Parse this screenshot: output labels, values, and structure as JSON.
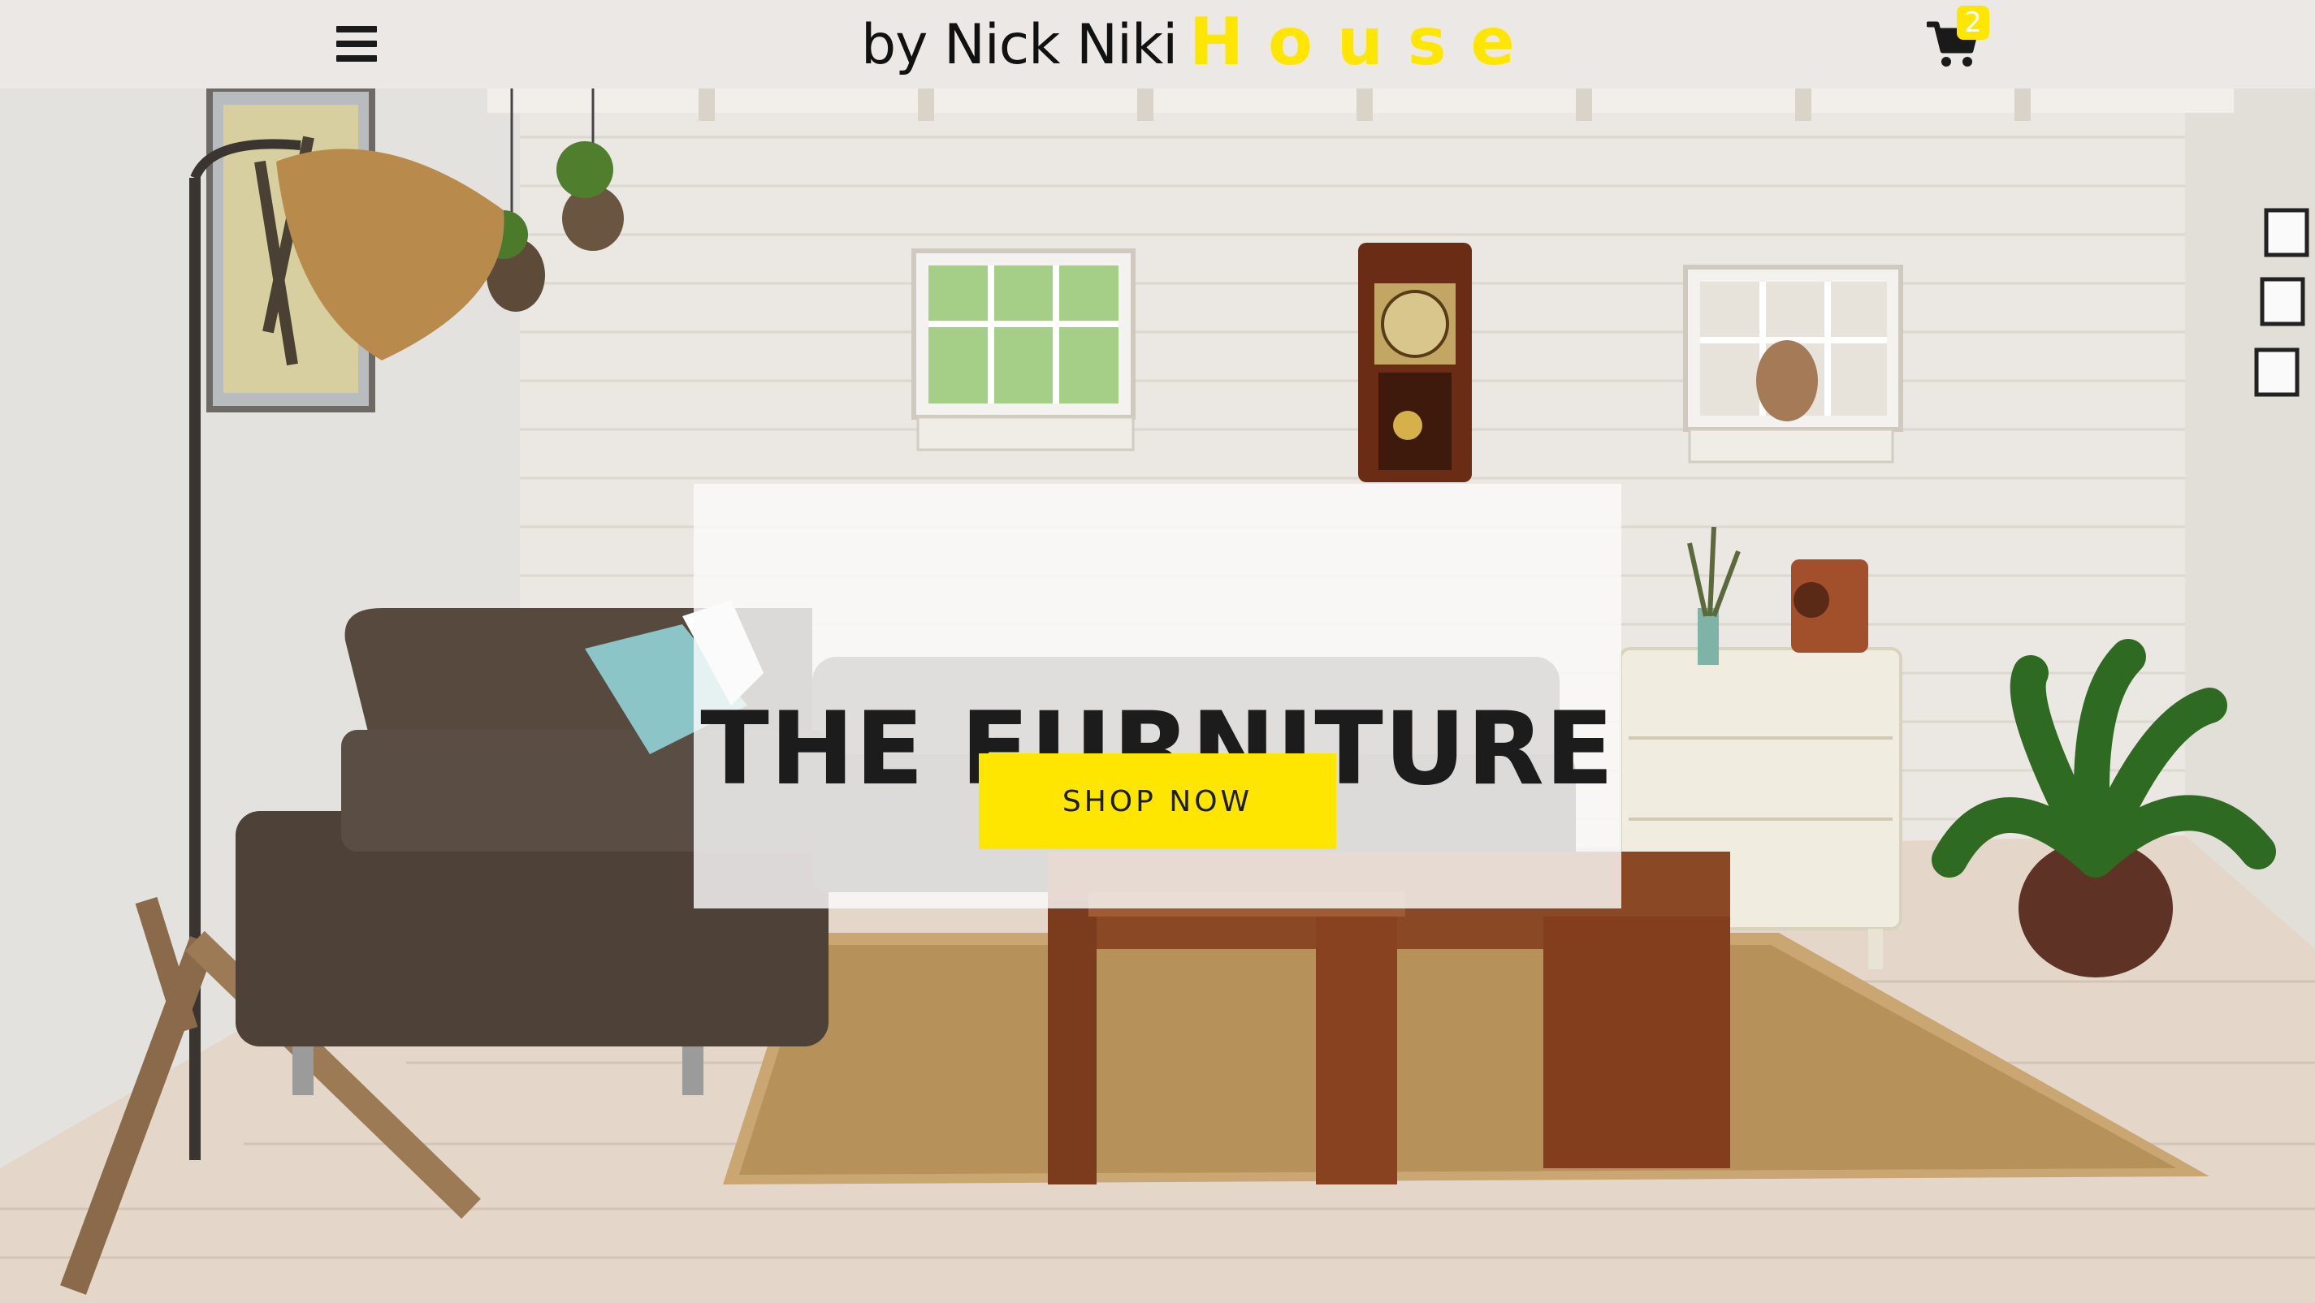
{
  "navbar": {
    "menu_icon": "hamburger-menu-icon",
    "brand_prefix": "by Nick Niki",
    "brand_name": "House",
    "brand_color": "#ffe600",
    "cart_icon": "shopping-cart-icon",
    "cart_count": "2"
  },
  "hero": {
    "title": "THE FURNITURE",
    "cta_label": "SHOP NOW",
    "cta_color": "#ffe600"
  }
}
